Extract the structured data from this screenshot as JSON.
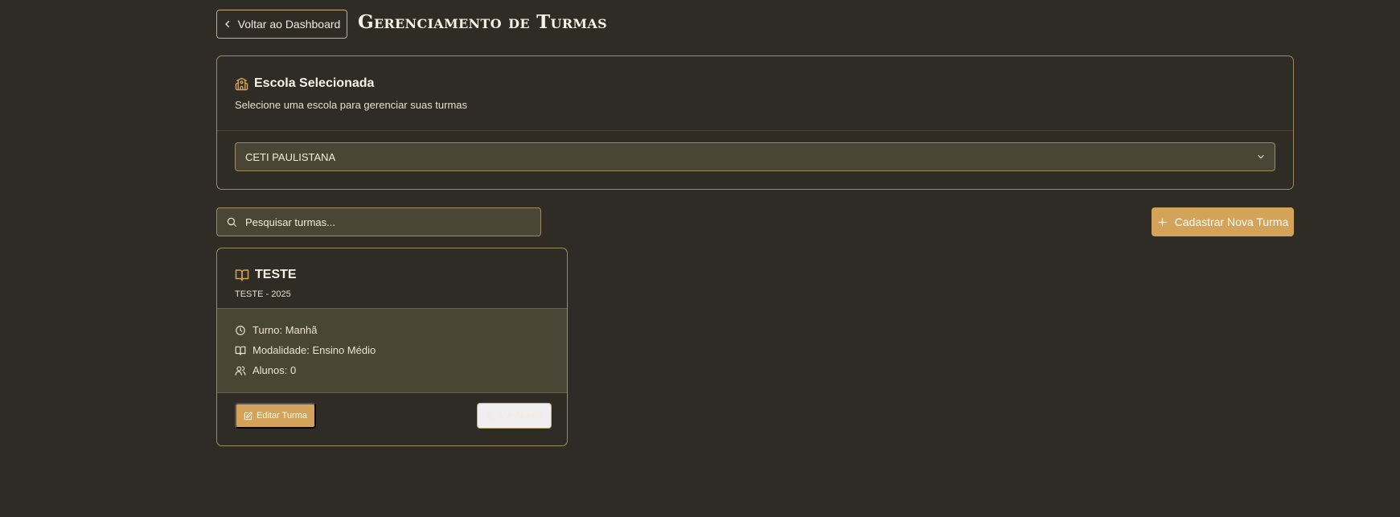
{
  "header": {
    "back_label": "Voltar ao Dashboard",
    "title": "Gerenciamento de Turmas"
  },
  "school": {
    "title": "Escola Selecionada",
    "description": "Selecione uma escola para gerenciar suas turmas",
    "selected": "CETI PAULISTANA",
    "icon": "school-icon"
  },
  "search": {
    "placeholder": "Pesquisar turmas...",
    "value": ""
  },
  "actions": {
    "add_label": "Cadastrar Nova Turma"
  },
  "classes": [
    {
      "name": "TESTE",
      "subtitle": "TESTE - 2025",
      "shift": "Turno: Manhã",
      "modality": "Modalidade: Ensino Médio",
      "students": "Alunos: 0",
      "edit_label": "Editar Turma",
      "view_label": "Ver Alunos"
    }
  ],
  "colors": {
    "background": "#2f2c25",
    "accent": "#d4a35a",
    "border": "#a08a62",
    "field": "#4a4636"
  }
}
